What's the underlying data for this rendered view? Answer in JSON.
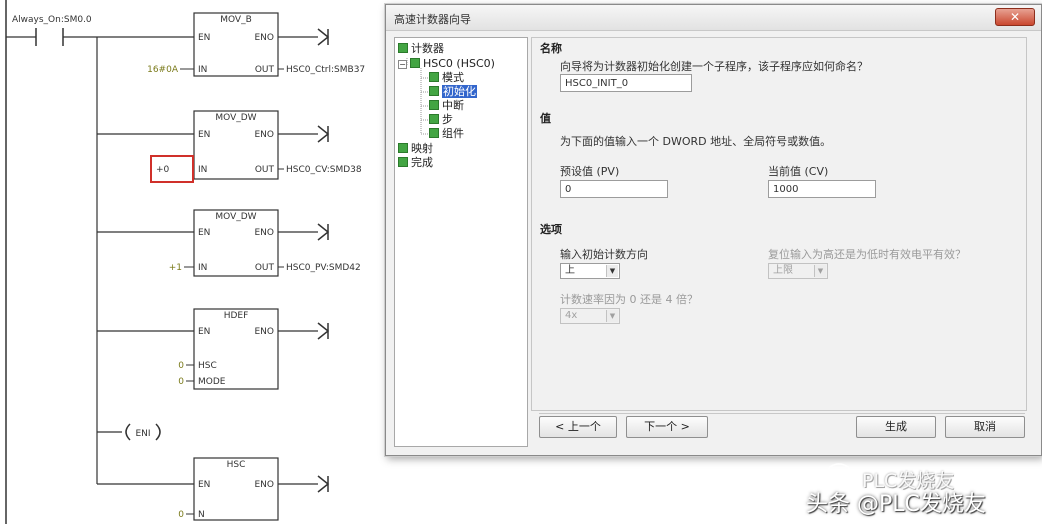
{
  "ladder": {
    "contact_label": "Always_On:SM0.0",
    "blocks": [
      {
        "name": "MOV_B",
        "en": "EN",
        "eno": "ENO",
        "in": "IN",
        "out": "OUT",
        "in_val": "16#0A",
        "out_val": "HSC0_Ctrl:SMB37"
      },
      {
        "name": "MOV_DW",
        "en": "EN",
        "eno": "ENO",
        "in": "IN",
        "out": "OUT",
        "in_val": "+0",
        "out_val": "HSC0_CV:SMD38"
      },
      {
        "name": "MOV_DW",
        "en": "EN",
        "eno": "ENO",
        "in": "IN",
        "out": "OUT",
        "in_val": "+1",
        "out_val": "HSC0_PV:SMD42"
      },
      {
        "name": "HDEF",
        "en": "EN",
        "eno": "ENO",
        "in1": "HSC",
        "in2": "MODE",
        "in1_val": "0",
        "in2_val": "0"
      },
      {
        "name": "HSC",
        "en": "EN",
        "eno": "ENO",
        "in1": "N",
        "in1_val": "0"
      }
    ],
    "eni_label": "ENI",
    "highlight_value": "+0"
  },
  "dialog": {
    "title": "高速计数器向导",
    "close_label": "✕",
    "tree": {
      "root": "计数器",
      "hsc": "HSC0 (HSC0)",
      "children": [
        "模式",
        "初始化",
        "中断",
        "步",
        "组件"
      ],
      "selected_child": "初始化",
      "after": [
        "映射",
        "完成"
      ]
    },
    "name_section": {
      "title": "名称",
      "prompt": "向导将为计数器初始化创建一个子程序，该子程序应如何命名？",
      "value": "HSC0_INIT_0"
    },
    "value_section": {
      "title": "值",
      "description": "为下面的值输入一个 DWORD 地址、全局符号或数值。",
      "preset_label": "预设值 (PV)",
      "preset_value": "0",
      "current_label": "当前值 (CV)",
      "current_value": "1000"
    },
    "options_section": {
      "title": "选项",
      "direction_label": "输入初始计数方向",
      "direction_value": "上",
      "reset_label": "复位输入为高还是为低时有效电平有效？",
      "reset_value": "上限",
      "rate_label": "计数速率因为 0 还是 4 倍？",
      "rate_value": "4x"
    },
    "buttons": {
      "prev": "< 上一个",
      "next": "下一个 >",
      "finish": "生成",
      "cancel": "取消"
    }
  },
  "watermark": {
    "line1": "PLC发烧友",
    "line2": "头条 @PLC发烧友"
  }
}
